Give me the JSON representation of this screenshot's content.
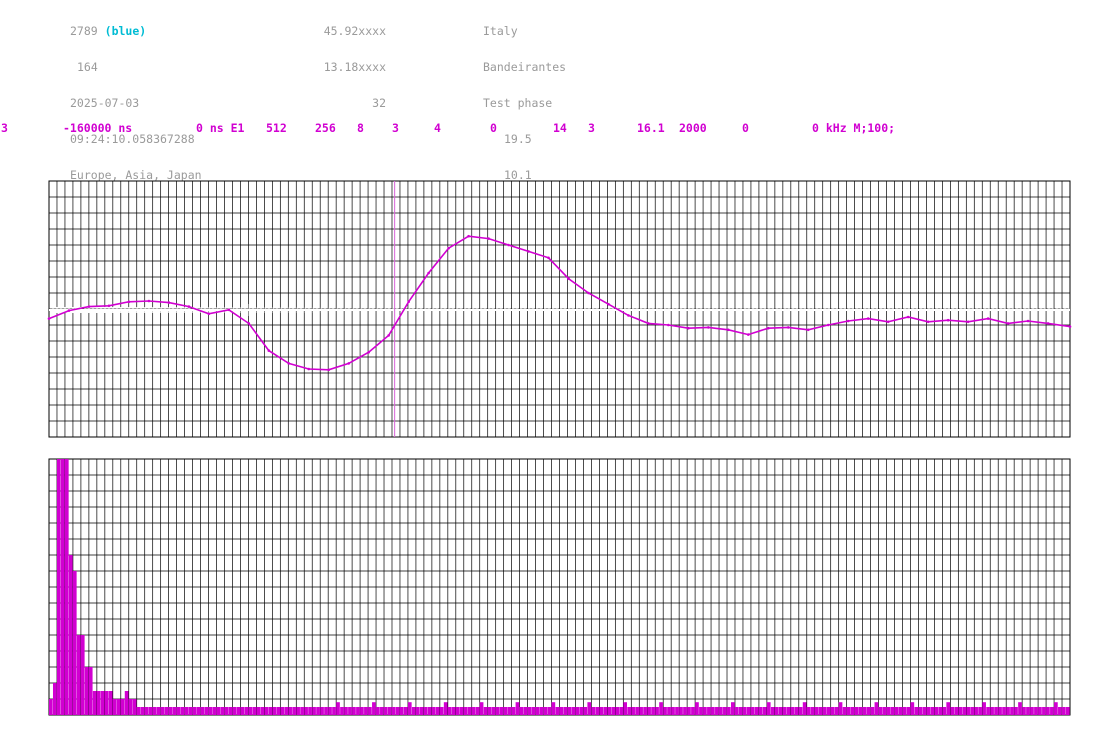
{
  "header": {
    "col1": [
      "2789",
      "164",
      "2025-07-03",
      "09:24:10.058367288",
      "Europe, Asia, Japan"
    ],
    "col1_tag": "(blue)",
    "col2": [
      "45.92xxxx",
      "13.18xxxx",
      "32"
    ],
    "col3": [
      "Italy",
      "Bandeirantes",
      "Test phase",
      "19.5",
      "10.1"
    ]
  },
  "params": [
    "3",
    "-160000 ns",
    "0 ns E1",
    "512",
    "256",
    "8",
    "3",
    "4",
    "0",
    "14",
    "3",
    "16.1",
    "2000",
    "0",
    "0 kHz M;100;"
  ],
  "colors": {
    "trace": "#d100d1",
    "grid": "#000000",
    "label": "#9a9a9a",
    "accent": "#00bcd4",
    "cursor": "#d860d8"
  },
  "chart_data": [
    {
      "type": "line",
      "x": [
        0,
        10,
        20,
        30,
        40,
        50,
        60,
        70,
        80,
        90,
        100,
        110,
        120,
        130,
        140,
        150,
        160,
        170,
        180,
        190,
        200,
        210,
        220,
        230,
        240,
        250,
        260,
        270,
        280,
        290,
        300,
        310,
        320,
        330,
        340,
        350,
        360,
        370,
        380,
        390,
        400,
        410,
        420,
        430,
        440,
        450,
        460,
        470,
        480,
        490,
        500,
        511
      ],
      "values": [
        -1.2,
        -0.2,
        0.3,
        0.4,
        0.9,
        1.0,
        0.8,
        0.3,
        -0.6,
        -0.1,
        -1.8,
        -5.2,
        -6.8,
        -7.5,
        -7.6,
        -6.8,
        -5.4,
        -3.3,
        0.9,
        4.5,
        7.6,
        9.1,
        8.8,
        8.0,
        7.2,
        6.4,
        3.8,
        2.0,
        0.6,
        -0.8,
        -1.8,
        -2.0,
        -2.4,
        -2.3,
        -2.6,
        -3.2,
        -2.4,
        -2.3,
        -2.6,
        -2.0,
        -1.5,
        -1.2,
        -1.6,
        -1.0,
        -1.6,
        -1.4,
        -1.6,
        -1.2,
        -1.8,
        -1.5,
        -1.8,
        -2.2
      ],
      "ylim": [
        -16,
        16
      ],
      "xlim": [
        0,
        511
      ],
      "cursor_x": 173,
      "grid": true
    },
    {
      "type": "bar",
      "values": [
        1,
        2,
        17,
        17,
        17,
        10,
        9,
        5,
        5,
        3,
        3,
        1.5,
        1.5,
        1.5,
        1.5,
        1.5,
        1,
        1,
        1,
        1.5,
        1,
        1,
        0.5,
        0.5,
        0.5,
        0.5,
        0.5,
        0.5,
        0.5,
        0.5,
        0.5,
        0.5,
        0.5,
        0.5,
        0.5,
        0.5,
        0.5,
        0.5,
        0.5,
        0.5,
        0.5,
        0.5,
        0.5,
        0.5,
        0.5,
        0.5,
        0.5,
        0.5,
        0.5,
        0.5,
        0.5,
        0.5,
        0.5,
        0.5,
        0.5,
        0.5,
        0.5,
        0.5,
        0.5,
        0.5,
        0.5,
        0.5,
        0.5,
        0.5
      ],
      "ylim": [
        0,
        16
      ],
      "grid": true
    }
  ]
}
